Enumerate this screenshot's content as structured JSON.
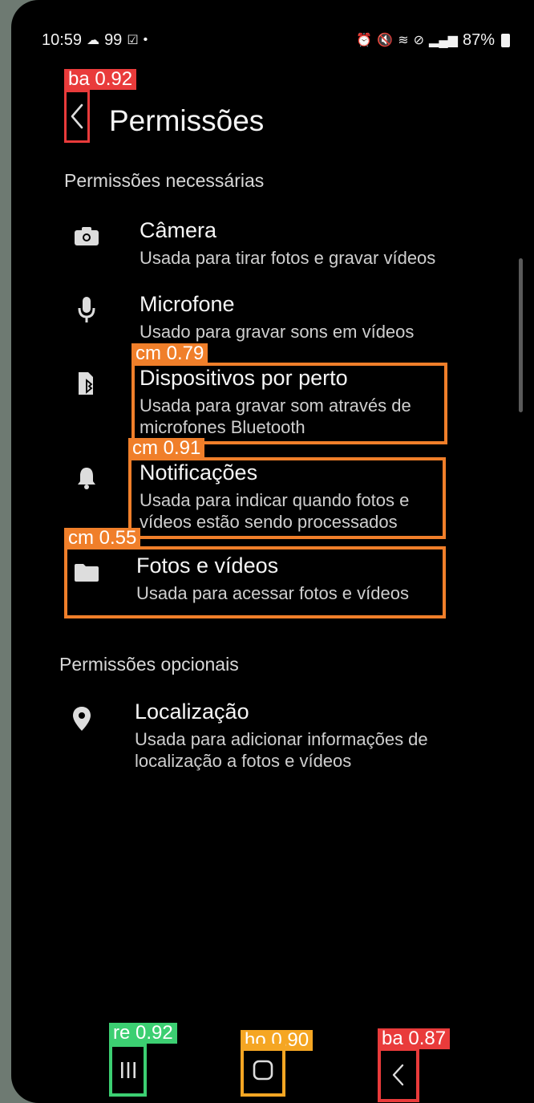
{
  "status": {
    "time": "10:59",
    "notif": "99",
    "battery": "87%"
  },
  "header": {
    "title": "Permissões"
  },
  "sections": {
    "required": "Permissões necessárias",
    "optional": "Permissões opcionais"
  },
  "permissions": {
    "camera": {
      "title": "Câmera",
      "desc": "Usada para tirar fotos e gravar vídeos"
    },
    "mic": {
      "title": "Microfone",
      "desc": "Usado para gravar sons em vídeos"
    },
    "nearby": {
      "title": "Dispositivos por perto",
      "desc": "Usada para gravar som através de microfones Bluetooth"
    },
    "notif": {
      "title": "Notificações",
      "desc": "Usada para indicar quando fotos e vídeos estão sendo processados"
    },
    "photos": {
      "title": "Fotos e vídeos",
      "desc": "Usada para acessar fotos e vídeos"
    },
    "location": {
      "title": "Localização",
      "desc": "Usada para adicionar informações de localização a fotos e vídeos"
    }
  },
  "detections": {
    "back_top": "ba 0.92",
    "nearby": "cm 0.79",
    "notif": "cm 0.91",
    "photos": "cm 0.55",
    "recents": "re 0.92",
    "home": "ho 0.90",
    "back_nav": "ba 0.87"
  },
  "colors": {
    "back": "#e93b3b",
    "component": "#f07f2a",
    "recents": "#3ccf72",
    "home": "#f5a623",
    "background": "#000000"
  }
}
